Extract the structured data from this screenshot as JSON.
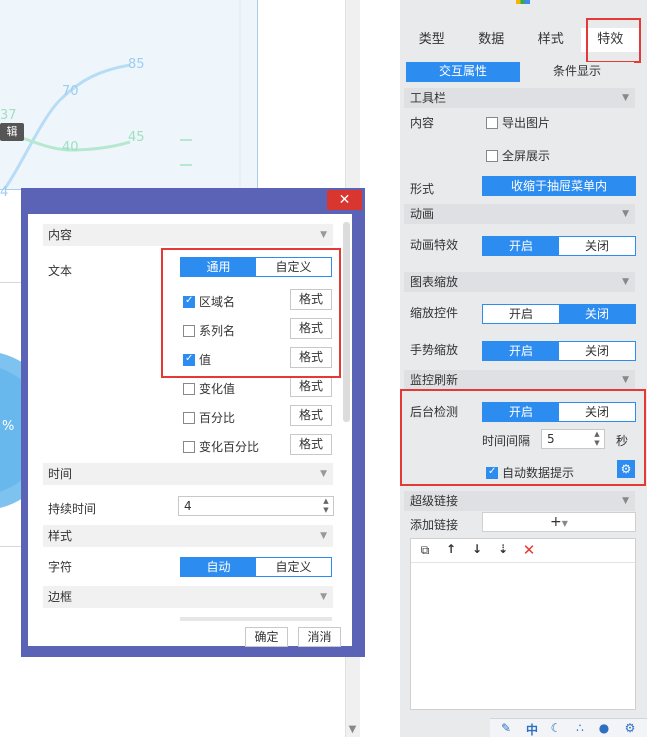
{
  "chart_bg": {
    "labels": {
      "v85": "85",
      "v70": "70",
      "v45": "45",
      "v40": "40",
      "v37": "37",
      "v4": "4",
      "edit": "辑",
      "pct": "%"
    }
  },
  "tabs": [
    "类型",
    "数据",
    "样式",
    "特效"
  ],
  "subtabs": {
    "left": "交互属性",
    "right": "条件显示"
  },
  "toolbar": {
    "title": "工具栏",
    "content_label": "内容",
    "export_image": "导出图片",
    "fullscreen": "全屏展示",
    "form_label": "形式",
    "form_value": "收缩于抽屉菜单内"
  },
  "animation": {
    "title": "动画",
    "effect_label": "动画特效",
    "on": "开启",
    "off": "关闭"
  },
  "zoom": {
    "title": "图表缩放",
    "control_label": "缩放控件",
    "gesture_label": "手势缩放",
    "on": "开启",
    "off": "关闭"
  },
  "monitor": {
    "title": "监控刷新",
    "backend_label": "后台检测",
    "on": "开启",
    "off": "关闭",
    "interval_label": "时间间隔",
    "interval_value": "5",
    "unit": "秒",
    "auto_tip": "自动数据提示"
  },
  "hyperlink": {
    "title": "超级链接",
    "add_label": "添加链接"
  },
  "dialog": {
    "content_section": "内容",
    "text_label": "文本",
    "mode_general": "通用",
    "mode_custom": "自定义",
    "items": [
      {
        "label": "区域名",
        "checked": true,
        "fmt": "格式"
      },
      {
        "label": "系列名",
        "checked": false,
        "fmt": "格式"
      },
      {
        "label": "值",
        "checked": true,
        "fmt": "格式"
      },
      {
        "label": "变化值",
        "checked": false,
        "fmt": "格式"
      },
      {
        "label": "百分比",
        "checked": false,
        "fmt": "格式"
      },
      {
        "label": "变化百分比",
        "checked": false,
        "fmt": "格式"
      }
    ],
    "time_section": "时间",
    "duration_label": "持续时间",
    "duration_value": "4",
    "style_section": "样式",
    "char_label": "字符",
    "char_auto": "自动",
    "char_custom": "自定义",
    "border_section": "边框",
    "ok": "确定",
    "cancel": "消消"
  },
  "colors": {
    "accent": "#2d8cf0",
    "red": "#e53935",
    "dialog_frame": "#5b63b7"
  }
}
